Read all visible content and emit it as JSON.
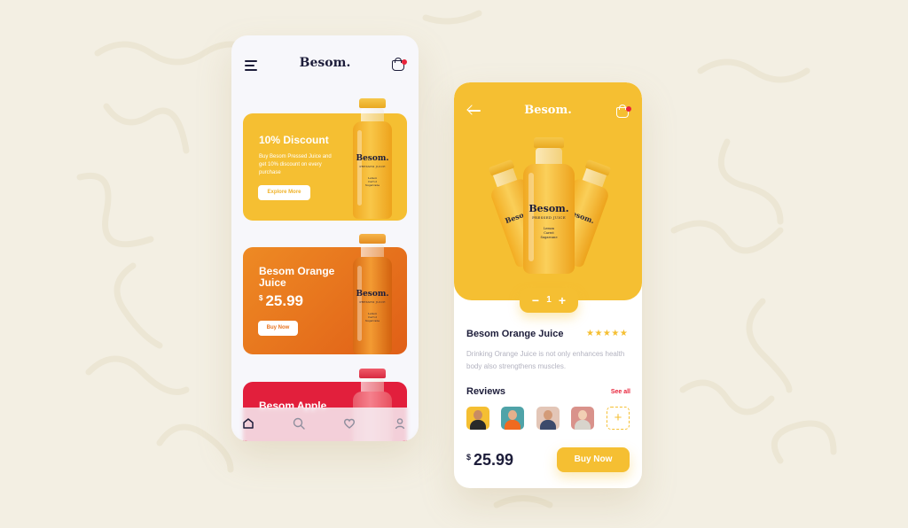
{
  "colors": {
    "yellow": "#f5bf32",
    "orange": "#e8731f",
    "red": "#e21f3c",
    "navy": "#1d1d3a",
    "background": "#f3efe3"
  },
  "home": {
    "brand": "Besom.",
    "menu_icon": "hamburger-menu-icon",
    "cart_icon": "shopping-bag-icon",
    "cards": [
      {
        "title": "10% Discount",
        "subtitle": "Buy Besom Pressed Juice and get 10% discount on every purchase",
        "button": "Explore More",
        "color": "#f5bf32"
      },
      {
        "title": "Besom Orange Juice",
        "currency": "$",
        "price": "25.99",
        "button": "Buy Now",
        "color": "#e8731f"
      },
      {
        "title": "Besom Apple",
        "color": "#e21f3c"
      }
    ],
    "tabs": [
      "home-icon",
      "search-icon",
      "heart-icon",
      "profile-icon"
    ]
  },
  "bottle_label": {
    "brand": "Besom.",
    "subtitle": "PRESSED JUICE",
    "ingredients": [
      "Lemon",
      "Carrot",
      "Sugarcane"
    ]
  },
  "detail": {
    "brand": "Besom.",
    "back_icon": "arrow-left-icon",
    "cart_icon": "shopping-bag-icon",
    "quantity": {
      "minus": "−",
      "value": "1",
      "plus": "+"
    },
    "product_name": "Besom Orange Juice",
    "rating": 5,
    "stars": "★★★★★",
    "description": "Drinking Orange Juice is not only enhances health body also strengthens muscles.",
    "reviews_title": "Reviews",
    "see_all": "See all",
    "add_review": "+",
    "currency": "$",
    "price": "25.99",
    "buy_button": "Buy Now"
  }
}
